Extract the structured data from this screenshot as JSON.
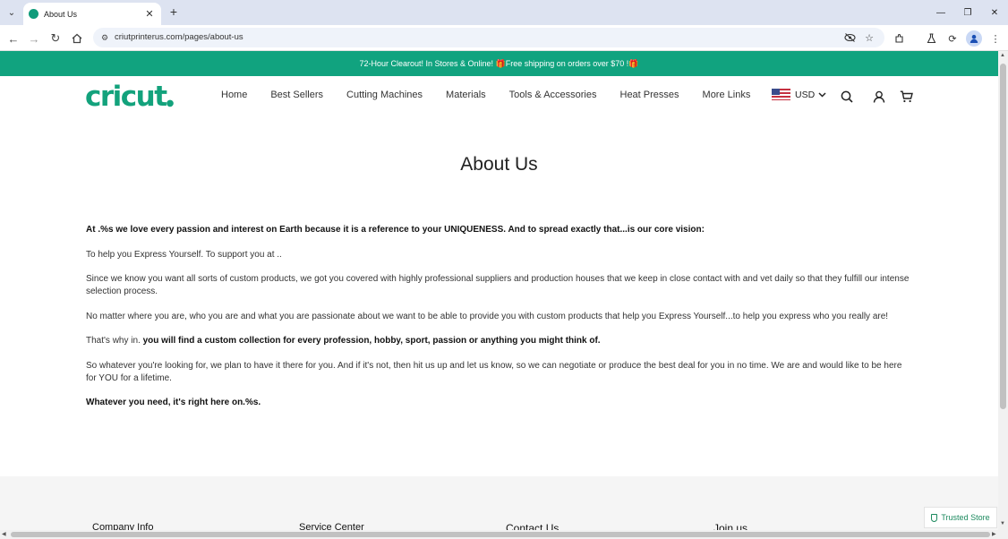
{
  "browser": {
    "tab_title": "About Us",
    "url": "criutprinterus.com/pages/about-us"
  },
  "announcement": "72-Hour Clearout! In Stores & Online! 🎁Free shipping on orders over $70 !🎁",
  "header": {
    "logo": "cricut",
    "nav": [
      "Home",
      "Best Sellers",
      "Cutting Machines",
      "Materials",
      "Tools & Accessories",
      "Heat Presses",
      "More Links"
    ],
    "currency": "USD"
  },
  "main": {
    "title": "About Us",
    "paragraphs": {
      "p1": "At .%s we love every passion and interest on Earth because it is a reference to your UNIQUENESS. And to spread exactly that...is our core vision:",
      "p2": "To help you Express Yourself. To support you at ..",
      "p3": "Since we know you want all sorts of custom products, we got you covered with highly professional suppliers and production houses that we keep in close contact with and vet daily so that they fulfill our intense selection process.",
      "p4": "No matter where you are, who you are and what you are passionate about we want to be able to provide you with custom products that help you Express Yourself...to help you express who you really are!",
      "p5_a": "That's why in.",
      "p5_b": " you will find a custom collection for every profession, hobby, sport, passion or anything you might think of.",
      "p6": "So whatever you're looking for, we plan to have it there for you. And if it's not, then hit us up and let us know, so we can negotiate or produce the best deal for you in no time. We are and would like to be here for YOU for a lifetime.",
      "p7": "Whatever you need, it's right here on.%s."
    }
  },
  "footer": {
    "columns": [
      "Company Info",
      "Service Center",
      "Contact Us",
      "Join us"
    ]
  },
  "trusted_badge": "Trusted Store",
  "colors": {
    "brand": "#13a27c",
    "announcement_bg": "#11a37f"
  }
}
